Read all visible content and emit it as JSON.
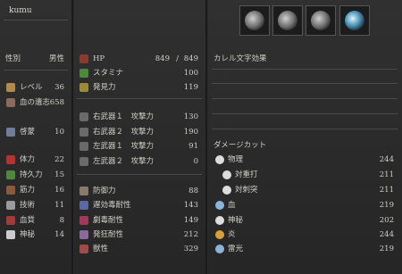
{
  "character": {
    "name": "kumu"
  },
  "left": {
    "gender_label": "性別",
    "gender_value": "男性",
    "stats": [
      {
        "label": "レベル",
        "value": "36",
        "icon": "level-icon",
        "color": "#b38a4a"
      },
      {
        "label": "血の遺志",
        "value": "658",
        "icon": "blood-echoes-icon",
        "color": "#8a6a5a"
      },
      {
        "label": "啓蒙",
        "value": "10",
        "icon": "insight-icon",
        "color": "#6f7f9a"
      },
      {
        "label": "体力",
        "value": "22",
        "icon": "vitality-icon",
        "color": "#b43232"
      },
      {
        "label": "持久力",
        "value": "15",
        "icon": "endurance-icon",
        "color": "#4a8a3a"
      },
      {
        "label": "筋力",
        "value": "16",
        "icon": "strength-icon",
        "color": "#8a5a3a"
      },
      {
        "label": "技術",
        "value": "11",
        "icon": "skill-icon",
        "color": "#9a9a9a"
      },
      {
        "label": "血質",
        "value": "8",
        "icon": "bloodtinge-icon",
        "color": "#a33a3a"
      },
      {
        "label": "神秘",
        "value": "14",
        "icon": "arcane-icon",
        "color": "#cccccc"
      }
    ]
  },
  "middle": {
    "hp": {
      "label": "HP",
      "current": "849",
      "sep": "/",
      "max": "849"
    },
    "stamina": {
      "label": "スタミナ",
      "value": "100"
    },
    "discovery": {
      "label": "発見力",
      "value": "119"
    },
    "attack": [
      {
        "label": "右武器１　攻撃力",
        "value": "130"
      },
      {
        "label": "右武器２　攻撃力",
        "value": "190"
      },
      {
        "label": "左武器１　攻撃力",
        "value": "91"
      },
      {
        "label": "左武器２　攻撃力",
        "value": "0"
      }
    ],
    "defense": [
      {
        "label": "防御力",
        "value": "88",
        "icon": "defense-icon",
        "color": "#8a7a6a"
      },
      {
        "label": "遅効毒耐性",
        "value": "143",
        "icon": "slow-poison-resist-icon",
        "color": "#5a6aa0"
      },
      {
        "label": "劇毒耐性",
        "value": "149",
        "icon": "rapid-poison-resist-icon",
        "color": "#a03a5a"
      },
      {
        "label": "発狂耐性",
        "value": "212",
        "icon": "frenzy-resist-icon",
        "color": "#8a6a9a"
      },
      {
        "label": "獣性",
        "value": "329",
        "icon": "beasthood-icon",
        "color": "#a04a4a"
      }
    ]
  },
  "right": {
    "rune_header": "カレル文字効果",
    "damage_cut_header": "ダメージカット",
    "cuts": [
      {
        "label": "物理",
        "value": "244",
        "icon": "physical-cut-icon",
        "color": "#ddd",
        "indent": false
      },
      {
        "label": "対重打",
        "value": "211",
        "icon": "blunt-cut-icon",
        "color": "#ddd",
        "indent": true
      },
      {
        "label": "対刺突",
        "value": "211",
        "icon": "thrust-cut-icon",
        "color": "#ddd",
        "indent": true
      },
      {
        "label": "血",
        "value": "219",
        "icon": "blood-cut-icon",
        "color": "#8ab4d8",
        "indent": false
      },
      {
        "label": "神秘",
        "value": "202",
        "icon": "arcane-cut-icon",
        "color": "#ddd",
        "indent": false
      },
      {
        "label": "炎",
        "value": "244",
        "icon": "fire-cut-icon",
        "color": "#d8a03a",
        "indent": false
      },
      {
        "label": "雷光",
        "value": "219",
        "icon": "bolt-cut-icon",
        "color": "#8ab4d8",
        "indent": false
      }
    ]
  }
}
